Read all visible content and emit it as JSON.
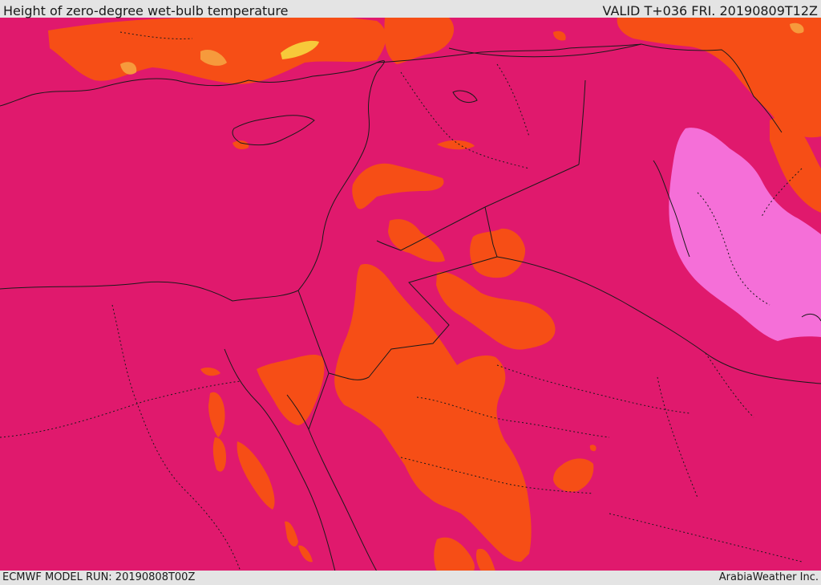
{
  "header": {
    "title": "Height of zero-degree wet-bulb temperature",
    "valid": "VALID T+036 FRI. 20190809T12Z"
  },
  "footer": {
    "model_run": "ECMWF MODEL RUN: 20190808T00Z",
    "credit": "ArabiaWeather Inc."
  },
  "colors": {
    "base_magenta": "#e0196d",
    "orange": "#f64e16",
    "light_orange": "#f69a3c",
    "yellow": "#f7c93a",
    "pink": "#f56fd8",
    "borders": "#1a1a1a"
  }
}
